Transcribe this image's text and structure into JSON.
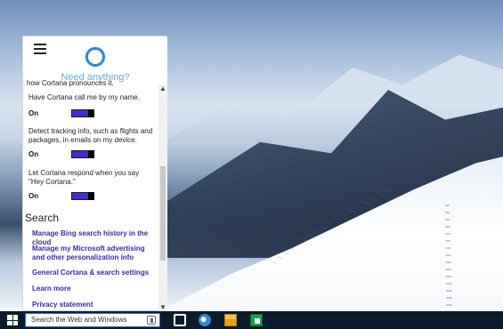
{
  "cortana": {
    "prompt": "Need anything?",
    "scroll_up_glyph": "▲",
    "scroll_down_glyph": "▼",
    "partial_text": "how Cortana pronounces it.",
    "settings": [
      {
        "description": "Have Cortana call me by my name.",
        "toggle_label": "On"
      },
      {
        "description": "Detect tracking info, such as flights and packages, in emails on my device.",
        "toggle_label": "On"
      },
      {
        "description": "Let Cortana respond when you say \"Hey Cortana.\"",
        "toggle_label": "On"
      }
    ],
    "section_title": "Search",
    "links": [
      "Manage Bing search history in the cloud",
      "Manage my Microsoft advertising and other personalization info",
      "General Cortana & search settings",
      "Learn more",
      "Privacy statement"
    ]
  },
  "taskbar": {
    "search_placeholder": "Search the Web and Windows"
  },
  "colors": {
    "cortana_blue": "#2a8bd8",
    "toggle_purple": "#3b2fcf",
    "link_purple": "#3c2aa8",
    "taskbar_bg": "#0b1b2c"
  },
  "icons": {
    "menu": "hamburger-icon",
    "cortana": "cortana-ring-icon",
    "windows": "windows-logo-icon",
    "mic": "microphone-icon",
    "taskview": "task-view-icon",
    "edge": "edge-icon",
    "explorer": "file-explorer-icon",
    "store": "store-icon"
  }
}
